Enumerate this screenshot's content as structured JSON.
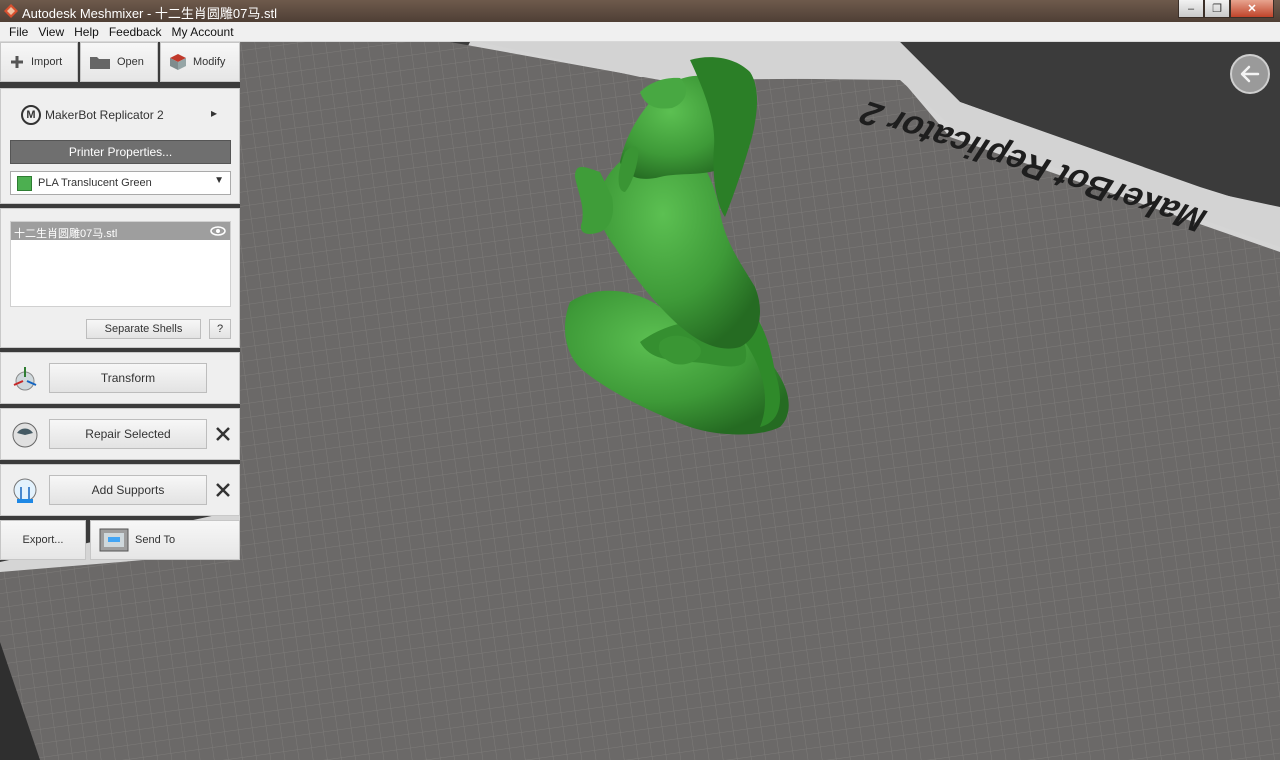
{
  "window": {
    "title": "Autodesk Meshmixer - 十二生肖圆雕07马.stl",
    "minimize": "–",
    "restore": "❐",
    "close": "✕"
  },
  "menu": [
    "File",
    "View",
    "Help",
    "Feedback",
    "My Account"
  ],
  "toolbar": {
    "import": "Import",
    "open": "Open",
    "modify": "Modify"
  },
  "printer": {
    "name": "MakerBot Replicator 2",
    "logo": "M",
    "arrow": "▸",
    "properties_label": "Printer Properties...",
    "material": "PLA Translucent Green",
    "material_color": "#4caf50",
    "dropdown_arrow": "▼"
  },
  "objects": {
    "items": [
      "十二生肖圆雕07马.stl"
    ],
    "separate_shells": "Separate Shells",
    "help": "?"
  },
  "actions": {
    "transform": "Transform",
    "repair": "Repair Selected",
    "supports": "Add Supports",
    "export": "Export...",
    "send_to": "Send To"
  },
  "colors": {
    "model": "#3e9a38",
    "bed": "#6b6968",
    "grid": "#7d7b79",
    "bed_frame": "#d5d5d5"
  },
  "bed_label": "MakerBot Replicator 2"
}
